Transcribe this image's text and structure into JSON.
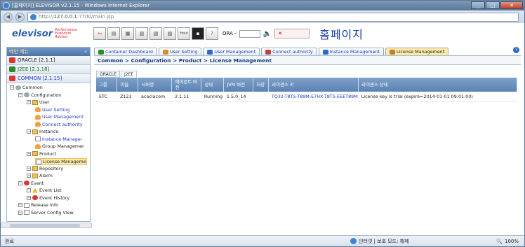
{
  "window": {
    "title": "[홈페이지] ELEVISOR v2.1.15 - Windows Internet Explorer",
    "controls": [
      "_",
      "□",
      "✕"
    ]
  },
  "address": {
    "url_prefix": "http://",
    "url_host": "127.0.0.1",
    "url_rest": ":7700/main.jsp"
  },
  "toolbar": {
    "logo": "elevisor",
    "tagline": [
      "Performance",
      "Evolution",
      "Advisor"
    ],
    "ora_label": "ORA -",
    "ora_value": "",
    "alert_text": "✕",
    "home_title": "홈페이지",
    "icons": [
      "exit-icon",
      "monitor-icon",
      "print-icon",
      "export-icon",
      "report-icon",
      "chart-icon",
      "hold-icon",
      "terminal-icon",
      "help-icon"
    ],
    "hold_label": "Hold"
  },
  "sidebar": {
    "header": "메인 메뉴",
    "collapse": "«",
    "sections": [
      {
        "label": "ORACLE [2.1.1]",
        "color": "#d33"
      },
      {
        "label": "J2EE [2.1.18]",
        "color": "#2a8a2a"
      },
      {
        "label": "COMMON [2.1.15]",
        "color": "#d33"
      }
    ],
    "tree": [
      {
        "label": "Common",
        "depth": 0,
        "icon": "gear"
      },
      {
        "label": "Configuration",
        "depth": 1,
        "icon": "gear"
      },
      {
        "label": "User",
        "depth": 2,
        "icon": "fold"
      },
      {
        "label": "User Setting",
        "depth": 3,
        "icon": "usr",
        "link": true
      },
      {
        "label": "User Management",
        "depth": 3,
        "icon": "usr",
        "link": true
      },
      {
        "label": "Connect authority",
        "depth": 3,
        "icon": "usr",
        "link": true
      },
      {
        "label": "Instance",
        "depth": 2,
        "icon": "fold"
      },
      {
        "label": "Instance Manager",
        "depth": 3,
        "icon": "doc",
        "link": true
      },
      {
        "label": "Group Managemer",
        "depth": 3,
        "icon": "usr"
      },
      {
        "label": "Product",
        "depth": 2,
        "icon": "fold"
      },
      {
        "label": "License Manageme",
        "depth": 3,
        "icon": "doc",
        "selected": true
      },
      {
        "label": "Repository",
        "depth": 2,
        "icon": "fold"
      },
      {
        "label": "Alarm",
        "depth": 2,
        "icon": "fold"
      },
      {
        "label": "Event",
        "depth": 1,
        "icon": "evt"
      },
      {
        "label": "Event List",
        "depth": 2,
        "icon": "warn"
      },
      {
        "label": "Event History",
        "depth": 2,
        "icon": "evt"
      },
      {
        "label": "Release Info",
        "depth": 1,
        "icon": "doc"
      },
      {
        "label": "Server Config View",
        "depth": 1,
        "icon": "doc"
      }
    ]
  },
  "tabs": [
    {
      "label": "Container Dashboard"
    },
    {
      "label": "User Setting"
    },
    {
      "label": "User Management"
    },
    {
      "label": "Connect authority"
    },
    {
      "label": "Instance Management"
    },
    {
      "label": "License Management",
      "active": true
    }
  ],
  "breadcrumb": "Common > Configuration > Product > License Management",
  "subtabs": [
    "ORACLE",
    "J2EE"
  ],
  "table": {
    "headers": [
      "그룹",
      "이름",
      "서버명",
      "에이전트 버전",
      "상태",
      "JVM 버전",
      "저장",
      "라이센스 키",
      "라이센스 상태"
    ],
    "rows": [
      [
        "ETC",
        "Z123",
        "acaciacom",
        "2.1.11",
        "Running",
        "1.5.0_14",
        "",
        "TQ32-T8TS-T89M-E7HX-T8TS-EEET89M",
        "License key is trial (expire=2014-01-01 09:01:00)"
      ]
    ]
  },
  "status": {
    "text": "완료",
    "zone": "인터넷 | 보호 모드: 해제",
    "zoom": "100%"
  }
}
